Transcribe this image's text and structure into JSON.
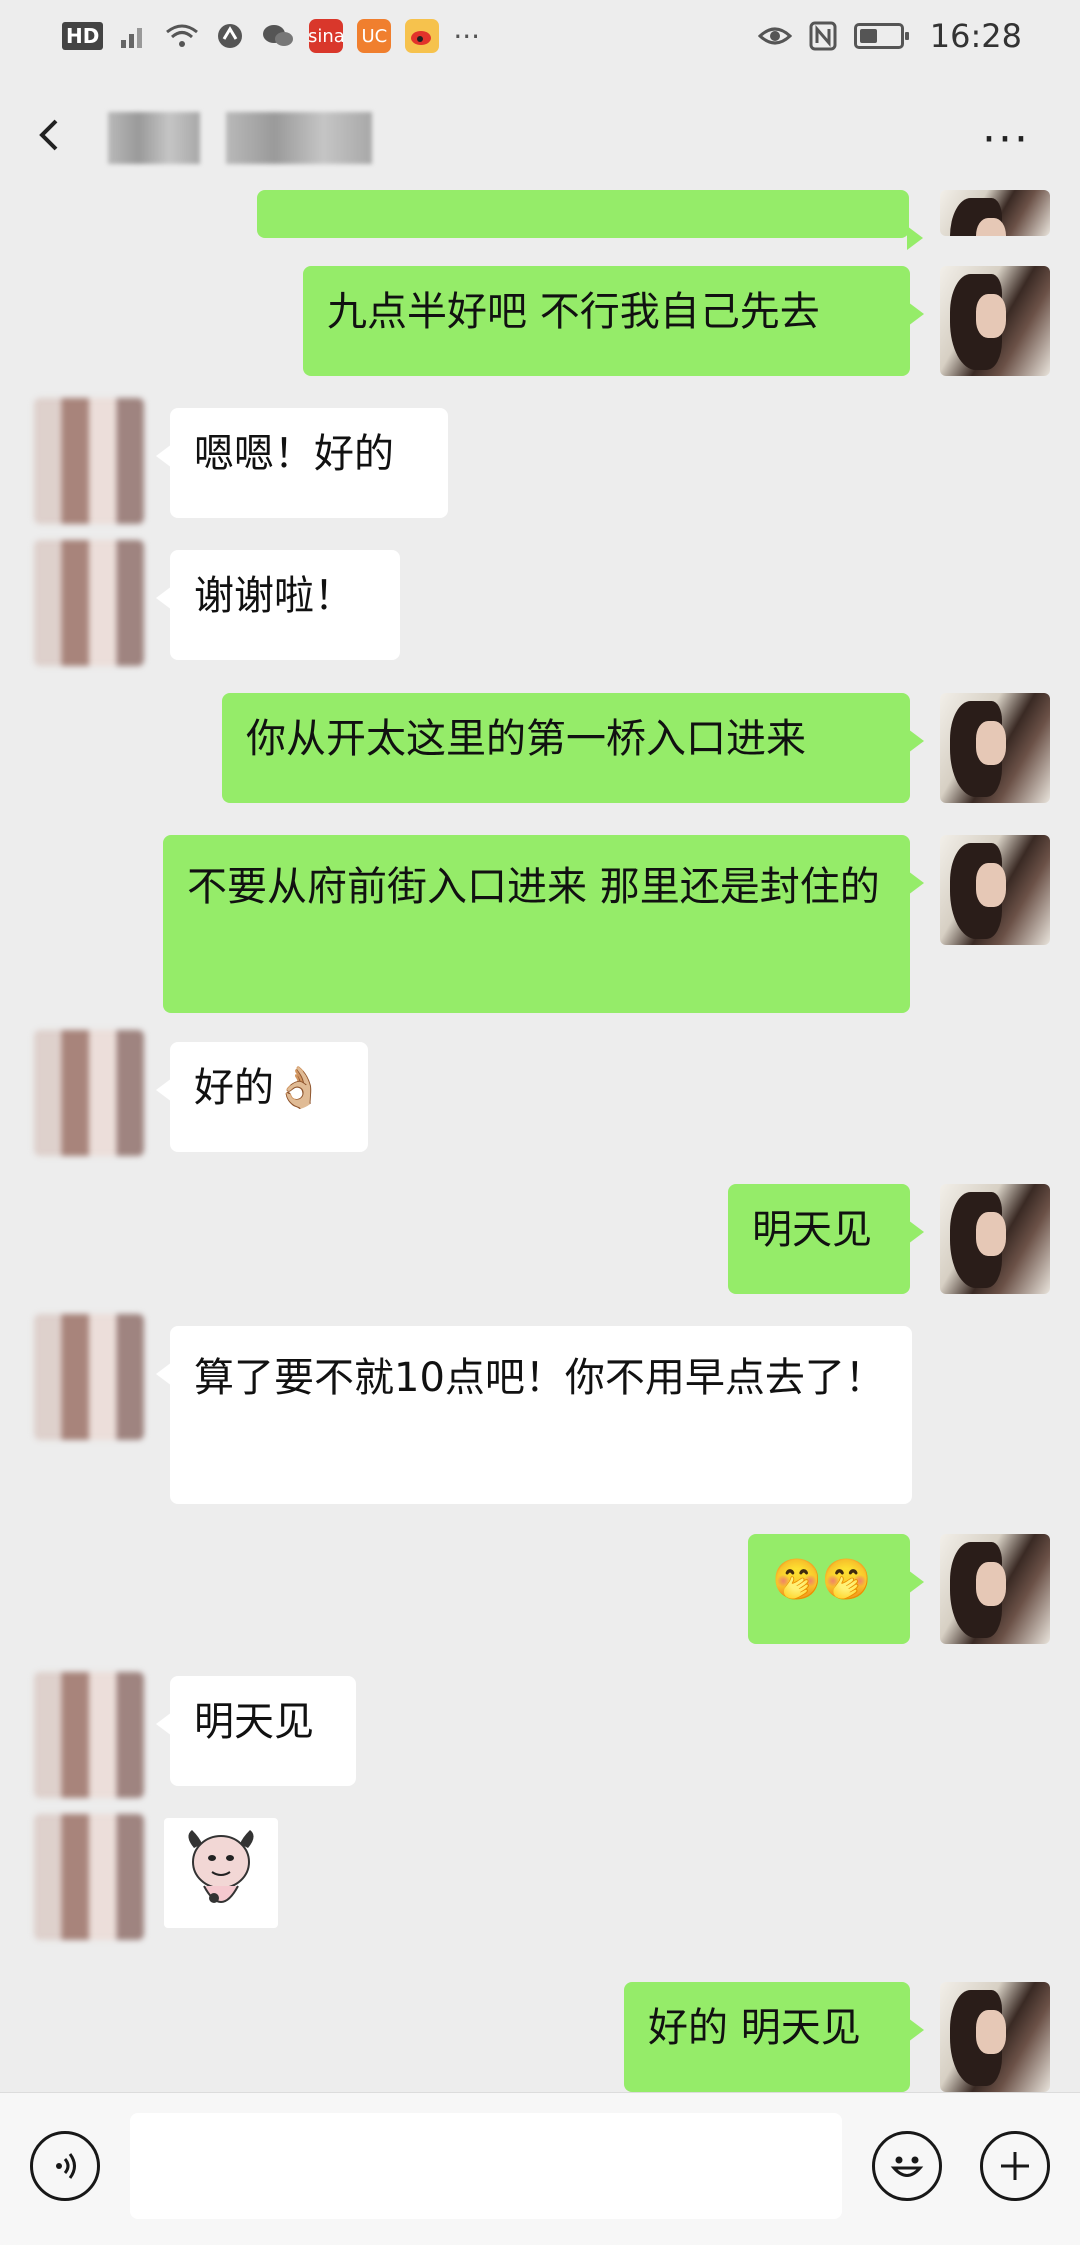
{
  "status_bar": {
    "left_badge": "HD",
    "signal_icon": "signal-icon",
    "wifi_icon": "wifi-icon",
    "apps": [
      "sina",
      "uc",
      "weibo"
    ],
    "more": "···",
    "time": "16:28",
    "battery_level": 0.45
  },
  "header": {
    "back_icon": "chevron-left-icon",
    "more_label": "···"
  },
  "messages": [
    {
      "side": "out",
      "text": ""
    },
    {
      "side": "out",
      "text": "九点半好吧 不行我自己先去"
    },
    {
      "side": "in",
      "text": "嗯嗯！好的"
    },
    {
      "side": "in",
      "text": "谢谢啦！"
    },
    {
      "side": "out",
      "text": "你从开太这里的第一桥入口进来"
    },
    {
      "side": "out",
      "text": "不要从府前街入口进来 那里还是封住的"
    },
    {
      "side": "in",
      "text": "好的👌🏼"
    },
    {
      "side": "out",
      "text": "明天见"
    },
    {
      "side": "in",
      "text": "算了要不就10点吧！你不用早点去了！"
    },
    {
      "side": "out",
      "text": "🤭🤭"
    },
    {
      "side": "in",
      "text": "明天见"
    },
    {
      "side": "in",
      "text": "",
      "sticker": "cow-sticker"
    },
    {
      "side": "out",
      "text": "好的 明天见"
    }
  ],
  "input_bar": {
    "voice_icon": "voice-icon",
    "emoji_icon": "emoji-icon",
    "plus_icon": "plus-icon",
    "placeholder": ""
  },
  "colors": {
    "background": "#ededed",
    "outgoing_bubble": "#95ec69",
    "incoming_bubble": "#ffffff"
  }
}
